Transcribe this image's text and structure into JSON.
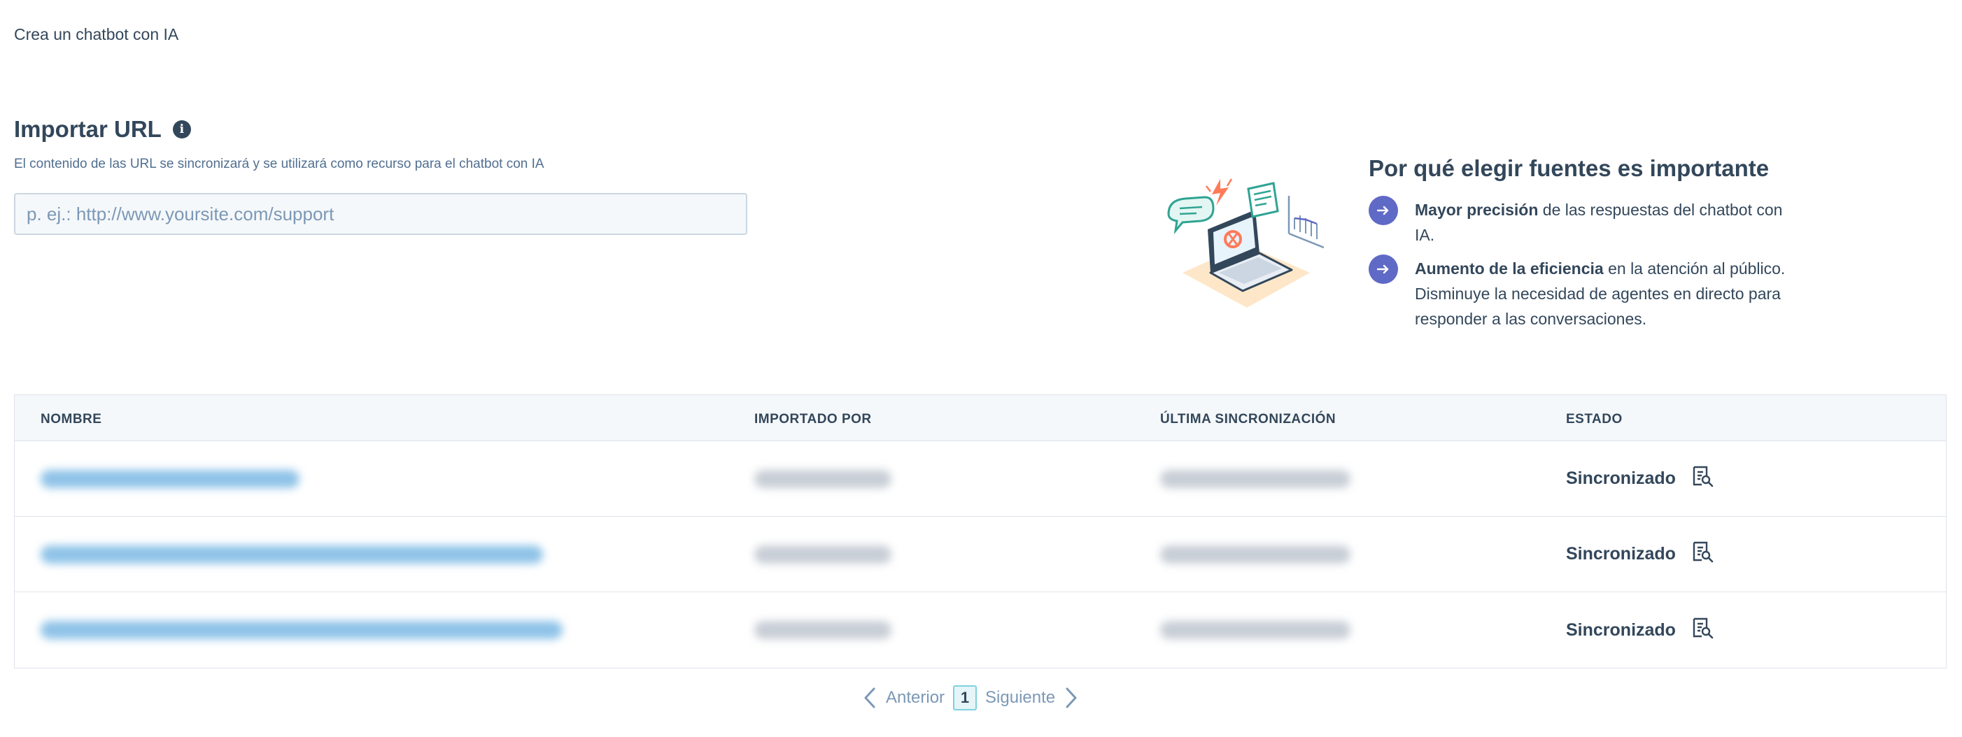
{
  "breadcrumb": "Crea un chatbot con IA",
  "import": {
    "title": "Importar URL",
    "info_icon": "info-icon",
    "description": "El contenido de las URL se sincronizará y se utilizará como recurso para el chatbot con IA",
    "placeholder": "p. ej.: http://www.yoursite.com/support"
  },
  "why": {
    "title": "Por qué elegir fuentes es importante",
    "benefits": [
      {
        "bold": "Mayor precisión",
        "text": " de las respuestas del chatbot con IA."
      },
      {
        "bold": "Aumento de la eficiencia",
        "text": " en la atención al público. Disminuye la necesidad de agentes en directo para responder a las conversaciones."
      }
    ]
  },
  "table": {
    "headers": [
      "NOMBRE",
      "IMPORTADO POR",
      "ÚLTIMA SINCRONIZACIÓN",
      "ESTADO"
    ],
    "rows": [
      {
        "status": "Sincronizado"
      },
      {
        "status": "Sincronizado"
      },
      {
        "status": "Sincronizado"
      }
    ]
  },
  "pagination": {
    "prev": "Anterior",
    "current": "1",
    "next": "Siguiente"
  },
  "colors": {
    "text": "#33475b",
    "accent": "#5f69c6",
    "link_blur": "#8fc3e8",
    "page_highlight": "#7fd1de"
  }
}
